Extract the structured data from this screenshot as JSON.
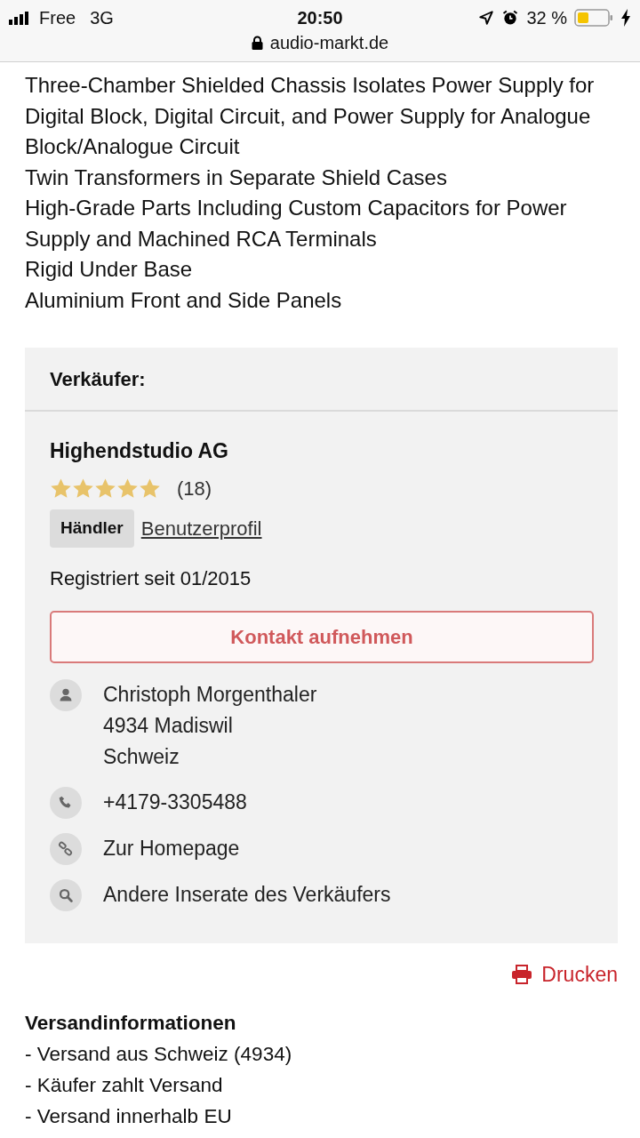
{
  "status_bar": {
    "carrier": "Free",
    "network": "3G",
    "time": "20:50",
    "battery": "32 %"
  },
  "address_bar": {
    "url": "audio-markt.de"
  },
  "features": [
    "Three-Chamber Shielded Chassis Isolates Power Supply for Digital Block, Digital Circuit, and Power Supply for Analogue Block/Analogue Circuit",
    "Twin Transformers in Separate Shield Cases",
    "High-Grade Parts Including Custom Capacitors for Power Supply and Machined RCA Terminals",
    "Rigid Under Base",
    "Aluminium Front and Side Panels"
  ],
  "seller": {
    "heading": "Verkäufer:",
    "name": "Highendstudio AG",
    "stars": 5,
    "rating_count": "(18)",
    "badge": "Händler",
    "profile_link": "Benutzerprofil",
    "registered": "Registriert seit 01/2015",
    "contact_button": "Kontakt aufnehmen",
    "details": [
      {
        "kind": "person",
        "lines": [
          "Christoph Morgenthaler",
          "4934 Madiswil",
          "Schweiz"
        ]
      },
      {
        "kind": "phone",
        "lines": [
          "+4179-3305488"
        ]
      },
      {
        "kind": "link",
        "lines": [
          "Zur Homepage"
        ]
      },
      {
        "kind": "search",
        "lines": [
          "Andere Inserate des Verkäufers"
        ]
      }
    ]
  },
  "print_link": "Drucken",
  "shipping": {
    "title": "Versandinformationen",
    "lines": [
      "- Versand aus Schweiz (4934)",
      "- Käufer zahlt Versand",
      "- Versand innerhalb EU"
    ]
  }
}
